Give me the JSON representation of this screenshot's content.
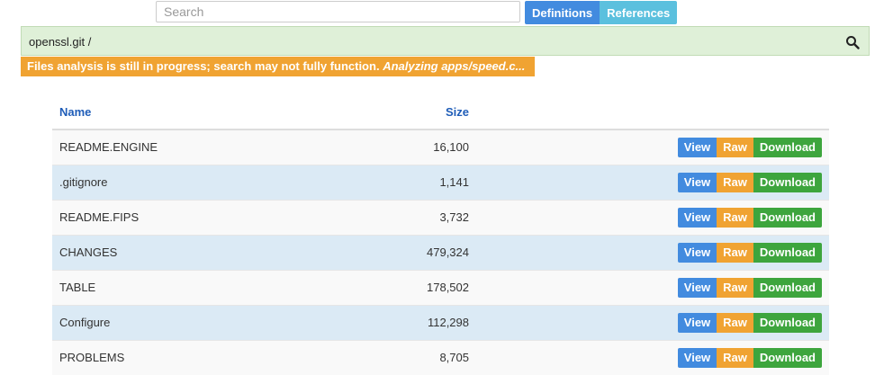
{
  "search": {
    "placeholder": "Search"
  },
  "toolbar": {
    "definitions_label": "Definitions",
    "references_label": "References"
  },
  "breadcrumb": {
    "path": "openssl.git /",
    "icon": "search-icon"
  },
  "warning": {
    "text": "Files analysis is still in progress; search may not fully function.",
    "status": "Analyzing apps/speed.c..."
  },
  "table": {
    "headers": {
      "name": "Name",
      "size": "Size"
    },
    "actions": {
      "view": "View",
      "raw": "Raw",
      "download": "Download"
    },
    "rows": [
      {
        "name": "README.ENGINE",
        "size": "16,100"
      },
      {
        "name": ".gitignore",
        "size": "1,141"
      },
      {
        "name": "README.FIPS",
        "size": "3,732"
      },
      {
        "name": "CHANGES",
        "size": "479,324"
      },
      {
        "name": "TABLE",
        "size": "178,502"
      },
      {
        "name": "Configure",
        "size": "112,298"
      },
      {
        "name": "PROBLEMS",
        "size": "8,705"
      }
    ]
  },
  "colors": {
    "view": "#428bdf",
    "raw": "#f0a332",
    "download": "#3da53d",
    "pathbar_bg": "#dff0d8",
    "warning_bg": "#f0a332",
    "header_text": "#1f5db8"
  }
}
